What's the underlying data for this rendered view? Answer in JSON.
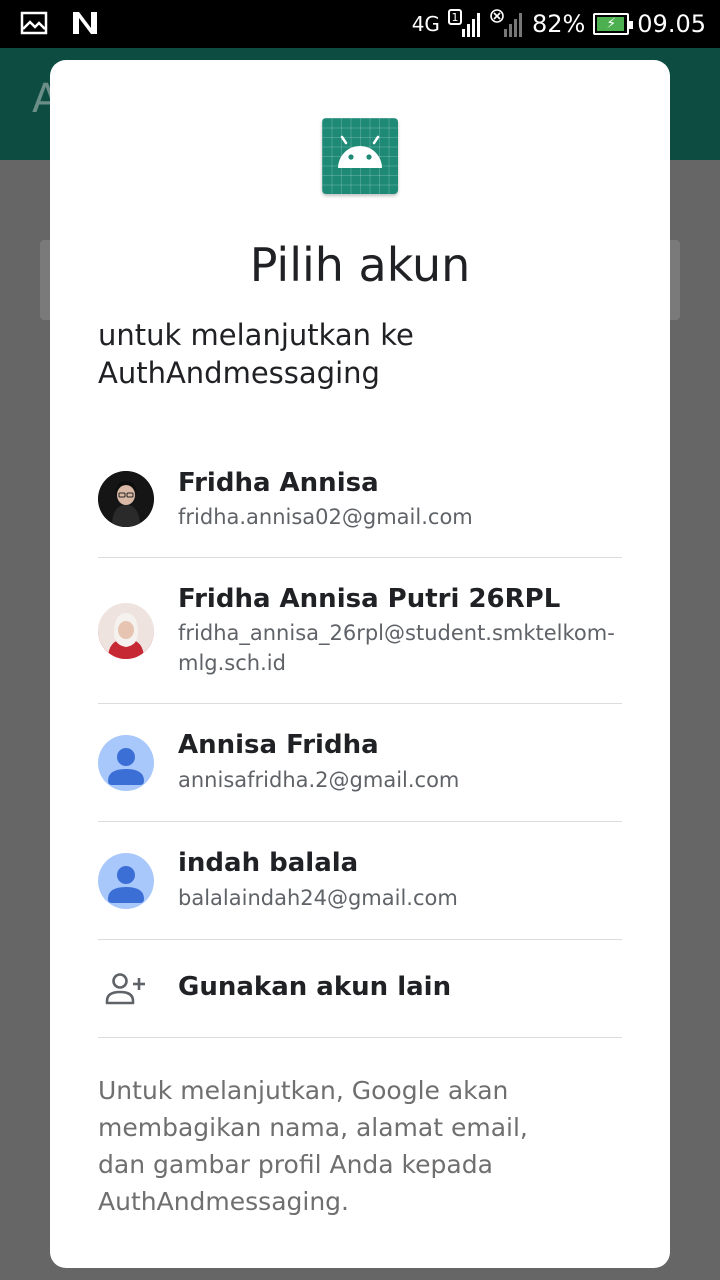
{
  "status_bar": {
    "network_label": "4G",
    "sim_badge": "1",
    "battery_percent": "82%",
    "time": "09.05",
    "icons": [
      "image-icon",
      "n-logo-icon",
      "signal-icon",
      "no-sim-signal-icon",
      "battery-charging-icon"
    ]
  },
  "background_app": {
    "title_letter": "A",
    "toolbar_color": "#0d4c41"
  },
  "dialog": {
    "title": "Pilih akun",
    "subtitle": "untuk melanjutkan ke AuthAndmessaging",
    "app_icon": "android-app-icon",
    "accounts": [
      {
        "name": "Fridha Annisa",
        "email": "fridha.annisa02@gmail.com",
        "avatar": "photo"
      },
      {
        "name": "Fridha Annisa Putri 26RPL",
        "email": "fridha_annisa_26rpl@student.smktelkom-mlg.sch.id",
        "avatar": "photo"
      },
      {
        "name": "Annisa Fridha",
        "email": "annisafridha.2@gmail.com",
        "avatar": "default-person-icon"
      },
      {
        "name": "indah balala",
        "email": "balalaindah24@gmail.com",
        "avatar": "default-person-icon"
      }
    ],
    "add_account_label": "Gunakan akun lain",
    "disclaimer": "Untuk melanjutkan, Google akan membagikan nama, alamat email, dan gambar profil Anda kepada AuthAndmessaging."
  },
  "colors": {
    "accent": "#1e8a76",
    "default_avatar_bg": "#a8c7fa",
    "default_avatar_fg": "#3b6fd6",
    "battery_fill": "#4caf50"
  }
}
